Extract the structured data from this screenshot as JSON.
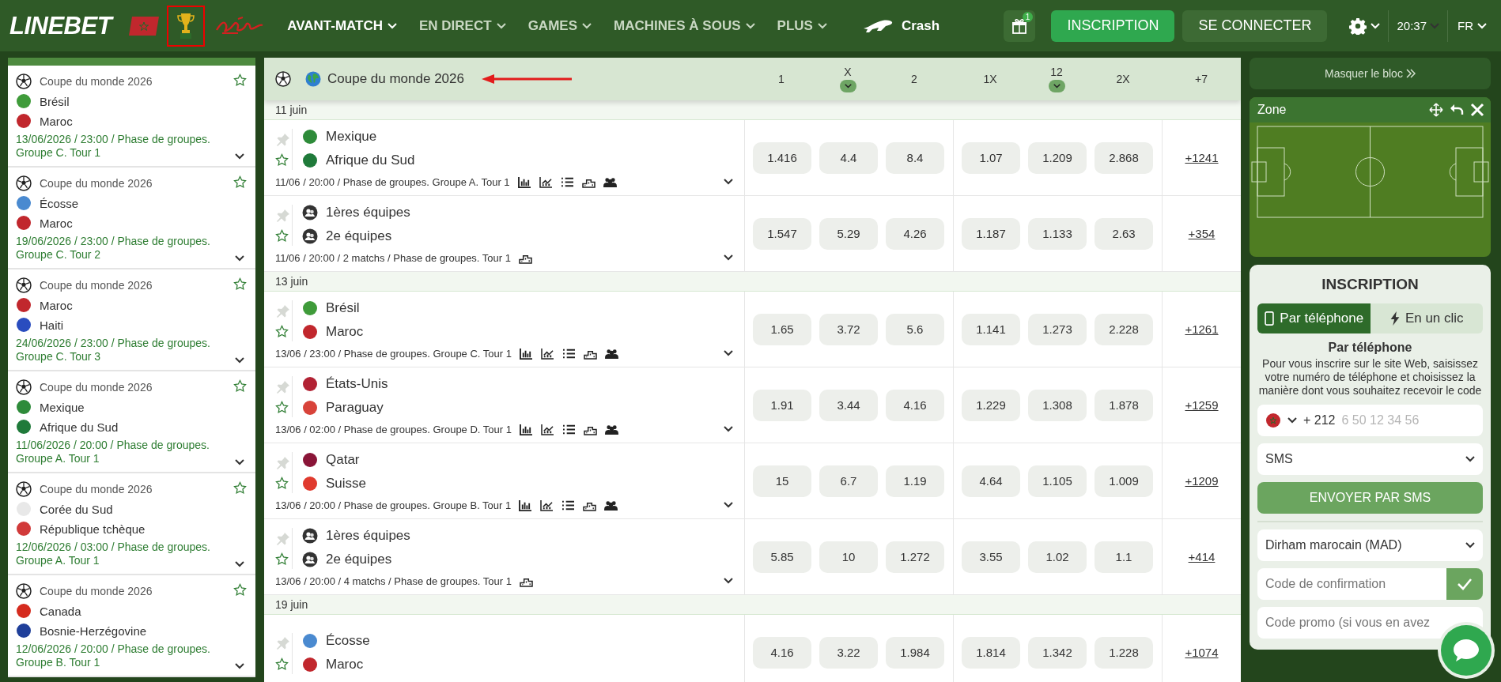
{
  "header": {
    "logo": "LINEBET",
    "nav": [
      {
        "label": "AVANT-MATCH",
        "selected": true
      },
      {
        "label": "EN DIRECT",
        "selected": false
      },
      {
        "label": "GAMES",
        "selected": false
      },
      {
        "label": "MACHINES À SOUS",
        "selected": false
      },
      {
        "label": "PLUS",
        "selected": false
      }
    ],
    "crash": "Crash",
    "gift_badge": "1",
    "register_button": "INSCRIPTION",
    "login_button": "SE CONNECTER",
    "time": "20:37",
    "language": "FR"
  },
  "sidebar": {
    "items": [
      {
        "league": "Coupe du monde 2026",
        "teams": [
          {
            "name": "Brésil",
            "color": "#3f9b3a"
          },
          {
            "name": "Maroc",
            "color": "#c1272d"
          }
        ],
        "info": "13/06/2026 / 23:00 / Phase de groupes. Groupe C. Tour 1"
      },
      {
        "league": "Coupe du monde 2026",
        "teams": [
          {
            "name": "Écosse",
            "color": "#4a8ad0"
          },
          {
            "name": "Maroc",
            "color": "#c1272d"
          }
        ],
        "info": "19/06/2026 / 23:00 / Phase de groupes. Groupe C. Tour 2"
      },
      {
        "league": "Coupe du monde 2026",
        "teams": [
          {
            "name": "Maroc",
            "color": "#c1272d"
          },
          {
            "name": "Haiti",
            "color": "#2a4dbf"
          }
        ],
        "info": "24/06/2026 / 23:00 / Phase de groupes. Groupe C. Tour 3"
      },
      {
        "league": "Coupe du monde 2026",
        "teams": [
          {
            "name": "Mexique",
            "color": "#2e8b3a"
          },
          {
            "name": "Afrique du Sud",
            "color": "#1f7a3a"
          }
        ],
        "info": "11/06/2026 / 20:00 / Phase de groupes. Groupe A. Tour 1"
      },
      {
        "league": "Coupe du monde 2026",
        "teams": [
          {
            "name": "Corée du Sud",
            "color": "#e8e8e8"
          },
          {
            "name": "République tchèque",
            "color": "#d13a3a"
          }
        ],
        "info": "12/06/2026 / 03:00 / Phase de groupes. Groupe A. Tour 1"
      },
      {
        "league": "Coupe du monde 2026",
        "teams": [
          {
            "name": "Canada",
            "color": "#d52b1e"
          },
          {
            "name": "Bosnie-Herzégovine",
            "color": "#1f3f9a"
          }
        ],
        "info": "12/06/2026 / 20:00 / Phase de groupes. Groupe B. Tour 1"
      }
    ]
  },
  "market": {
    "competition": "Coupe du monde 2026",
    "columns": [
      {
        "label": "1",
        "dropdown": false
      },
      {
        "label": "X",
        "dropdown": true
      },
      {
        "label": "2",
        "dropdown": false
      },
      {
        "label": "1X",
        "dropdown": false
      },
      {
        "label": "12",
        "dropdown": true
      },
      {
        "label": "2X",
        "dropdown": false
      }
    ],
    "more_column": "+7",
    "days": [
      {
        "label": "11 juin",
        "matches": [
          {
            "kind": "match",
            "teams": [
              {
                "kind": "flag",
                "name": "Mexique",
                "color": "#2e8b3a"
              },
              {
                "kind": "flag",
                "name": "Afrique du Sud",
                "color": "#1f7a3a"
              }
            ],
            "info": "11/06 / 20:00 / Phase de groupes. Groupe A. Tour 1",
            "odds": [
              "1.416",
              "4.4",
              "8.4",
              "1.07",
              "1.209",
              "2.868"
            ],
            "more": "+1241"
          },
          {
            "kind": "aggregate",
            "teams": [
              {
                "kind": "generic",
                "name": "1ères équipes"
              },
              {
                "kind": "generic",
                "name": "2e équipes"
              }
            ],
            "info": "11/06 / 20:00 / 2 matchs / Phase de groupes. Tour 1",
            "odds": [
              "1.547",
              "5.29",
              "4.26",
              "1.187",
              "1.133",
              "2.63"
            ],
            "more": "+354"
          }
        ]
      },
      {
        "label": "13 juin",
        "matches": [
          {
            "kind": "match",
            "teams": [
              {
                "kind": "flag",
                "name": "Brésil",
                "color": "#3f9b3a"
              },
              {
                "kind": "flag",
                "name": "Maroc",
                "color": "#c1272d"
              }
            ],
            "info": "13/06 / 23:00 / Phase de groupes. Groupe C. Tour 1",
            "odds": [
              "1.65",
              "3.72",
              "5.6",
              "1.141",
              "1.273",
              "2.228"
            ],
            "more": "+1261"
          },
          {
            "kind": "match",
            "teams": [
              {
                "kind": "flag",
                "name": "États-Unis",
                "color": "#b22234"
              },
              {
                "kind": "flag",
                "name": "Paraguay",
                "color": "#d8433a"
              }
            ],
            "info": "13/06 / 02:00 / Phase de groupes. Groupe D. Tour 1",
            "odds": [
              "1.91",
              "3.44",
              "4.16",
              "1.229",
              "1.308",
              "1.878"
            ],
            "more": "+1259"
          },
          {
            "kind": "match",
            "teams": [
              {
                "kind": "flag",
                "name": "Qatar",
                "color": "#8a1538"
              },
              {
                "kind": "flag",
                "name": "Suisse",
                "color": "#e03a2e"
              }
            ],
            "info": "13/06 / 20:00 / Phase de groupes. Groupe B. Tour 1",
            "odds": [
              "15",
              "6.7",
              "1.19",
              "4.64",
              "1.105",
              "1.009"
            ],
            "more": "+1209"
          },
          {
            "kind": "aggregate",
            "teams": [
              {
                "kind": "generic",
                "name": "1ères équipes"
              },
              {
                "kind": "generic",
                "name": "2e équipes"
              }
            ],
            "info": "13/06 / 20:00 / 4 matchs / Phase de groupes. Tour 1",
            "odds": [
              "5.85",
              "10",
              "1.272",
              "3.55",
              "1.02",
              "1.1"
            ],
            "more": "+414"
          }
        ]
      },
      {
        "label": "19 juin",
        "matches": [
          {
            "teams": [
              {
                "kind": "flag",
                "name": "Écosse",
                "color": "#4a8ad0"
              },
              {
                "kind": "flag",
                "name": "Maroc",
                "color": "#c1272d"
              }
            ],
            "odds": [
              "4.16",
              "3.22",
              "1.984",
              "1.814",
              "1.342",
              "1.228"
            ],
            "more": "+1074"
          }
        ]
      }
    ]
  },
  "right_panel": {
    "hide_button": "Masquer le bloc",
    "zone_title": "Zone",
    "registration": {
      "title": "INSCRIPTION",
      "tabs": [
        {
          "label": "Par téléphone",
          "selected": true
        },
        {
          "label": "En un clic",
          "selected": false
        }
      ],
      "subtitle": "Par téléphone",
      "description": "Pour vous inscrire sur le site Web, saisissez votre numéro de téléphone et choisissez la manière dont vous souhaitez recevoir le code",
      "phone_prefix": "+ 212",
      "phone_placeholder": "6 50 12 34 56",
      "method": "SMS",
      "send_button": "ENVOYER PAR SMS",
      "currency": "Dirham marocain (MAD)",
      "confirmation_placeholder": "Code de confirmation",
      "promo_placeholder": "Code promo (si vous en avez"
    }
  }
}
